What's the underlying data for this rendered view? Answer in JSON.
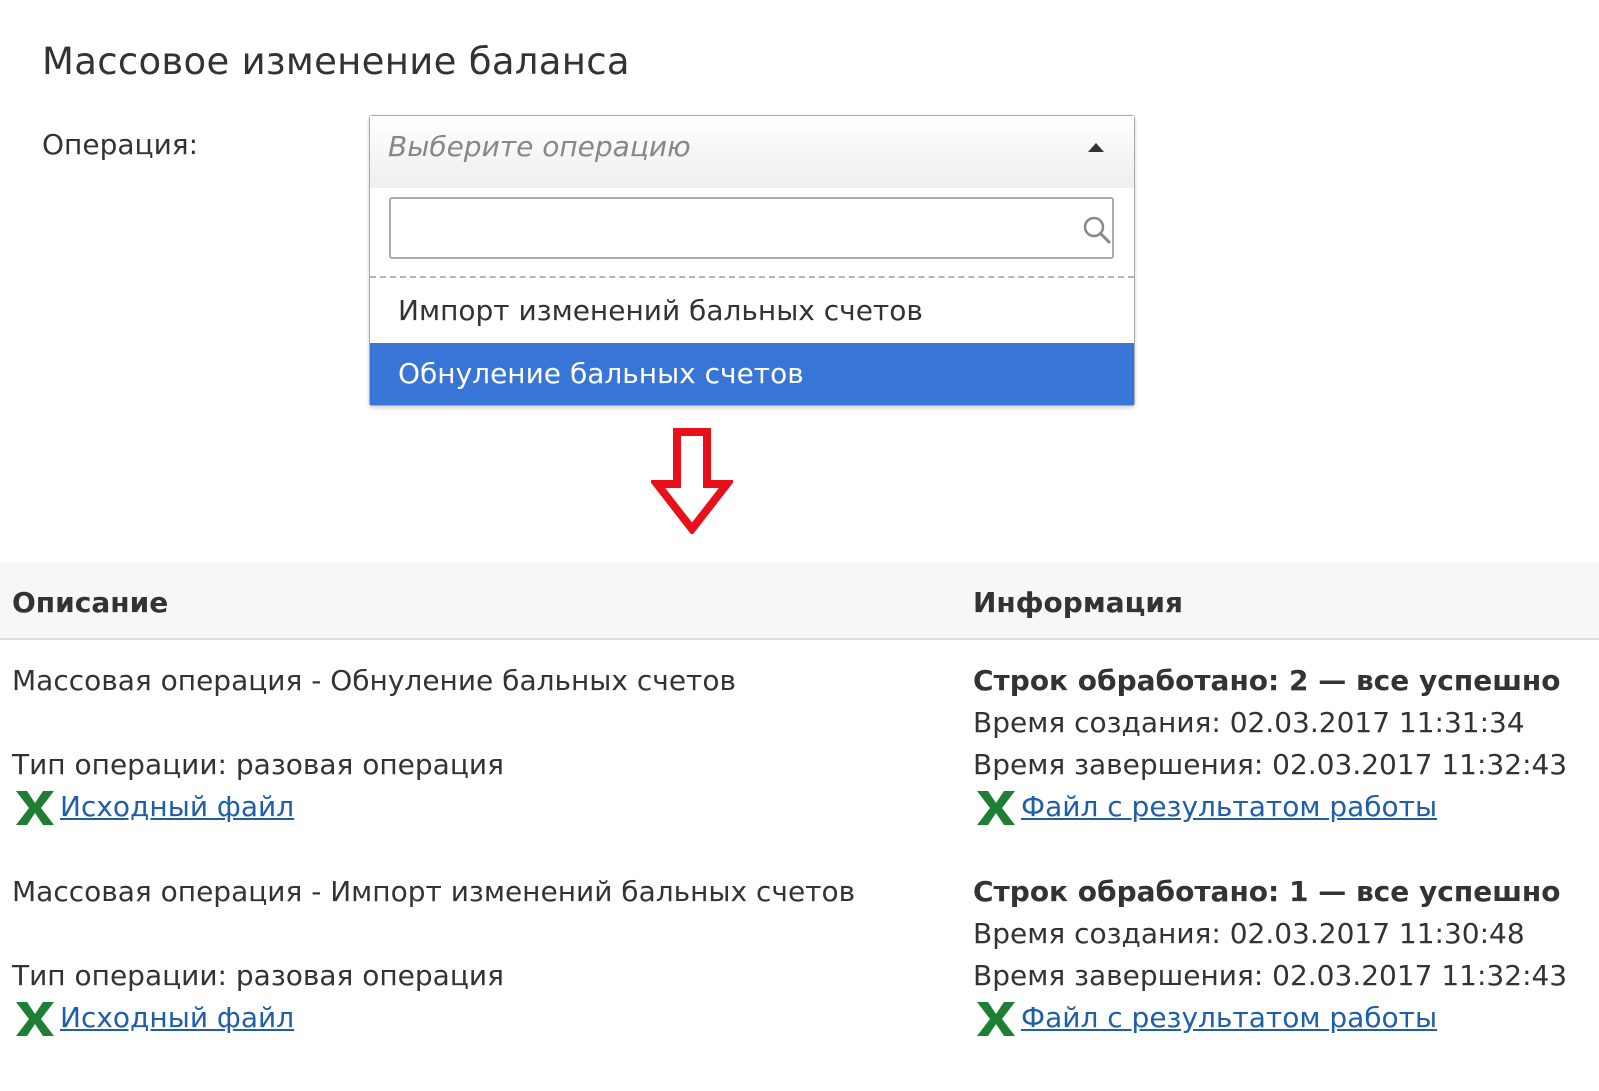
{
  "page": {
    "title": "Массовое изменение баланса"
  },
  "form": {
    "operation_label": "Операция:",
    "select": {
      "placeholder": "Выберите операцию",
      "search_value": "",
      "options": [
        {
          "label": "Импорт изменений бальных счетов",
          "highlighted": false
        },
        {
          "label": "Обнуление бальных счетов",
          "highlighted": true
        }
      ]
    }
  },
  "table": {
    "headers": {
      "description": "Описание",
      "info": "Информация"
    },
    "rows": [
      {
        "description": "Массовая операция - Обнуление бальных счетов",
        "type": "Тип операции: разовая операция",
        "source_link": "Исходный файл",
        "status": "Строк обработано: 2 — все успешно",
        "created": "Время создания: 02.03.2017 11:31:34",
        "finished": "Время завершения: 02.03.2017 11:32:43",
        "result_link": "Файл с результатом работы"
      },
      {
        "description": "Массовая операция - Импорт изменений бальных счетов",
        "type": "Тип операции: разовая операция",
        "source_link": "Исходный файл",
        "status": "Строк обработано: 1 — все успешно",
        "created": "Время создания: 02.03.2017 11:30:48",
        "finished": "Время завершения: 02.03.2017 11:32:43",
        "result_link": "Файл с результатом работы"
      }
    ]
  },
  "colors": {
    "highlight": "#3875d7",
    "link": "#1f5ea8",
    "arrow": "#e8101a",
    "excel_icon": "#1e7e34"
  },
  "icons": {
    "search": "search-icon",
    "arrow": "down-arrow-icon",
    "file": "excel-icon"
  }
}
